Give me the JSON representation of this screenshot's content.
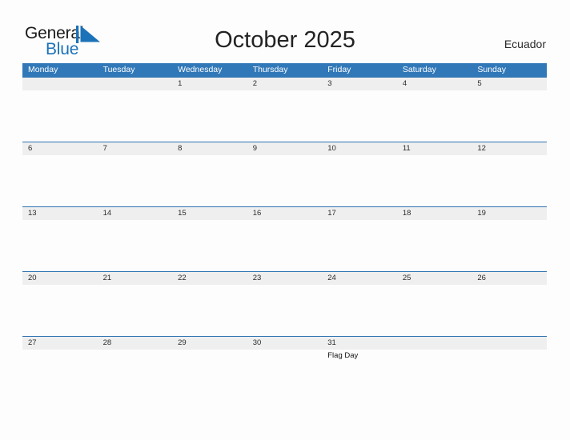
{
  "brand": {
    "line1": "General",
    "line2": "Blue",
    "mark_icon": "blue-triangle-logo-icon",
    "accent_color": "#1b72b8",
    "text_color": "#1a1a1a"
  },
  "header": {
    "title": "October 2025",
    "region": "Ecuador"
  },
  "colors": {
    "header_blue": "#3178b8",
    "row_band_gray": "#efefef",
    "row_rule_blue": "#2f74b3",
    "page_background": "#fdfdfd",
    "text_dark": "#2b2b2b"
  },
  "calendar": {
    "month": "October",
    "year": "2025",
    "weekday_headers": [
      "Monday",
      "Tuesday",
      "Wednesday",
      "Thursday",
      "Friday",
      "Saturday",
      "Sunday"
    ],
    "weeks": [
      [
        {
          "day": "",
          "event": ""
        },
        {
          "day": "",
          "event": ""
        },
        {
          "day": "1",
          "event": ""
        },
        {
          "day": "2",
          "event": ""
        },
        {
          "day": "3",
          "event": ""
        },
        {
          "day": "4",
          "event": ""
        },
        {
          "day": "5",
          "event": ""
        }
      ],
      [
        {
          "day": "6",
          "event": ""
        },
        {
          "day": "7",
          "event": ""
        },
        {
          "day": "8",
          "event": ""
        },
        {
          "day": "9",
          "event": ""
        },
        {
          "day": "10",
          "event": ""
        },
        {
          "day": "11",
          "event": ""
        },
        {
          "day": "12",
          "event": ""
        }
      ],
      [
        {
          "day": "13",
          "event": ""
        },
        {
          "day": "14",
          "event": ""
        },
        {
          "day": "15",
          "event": ""
        },
        {
          "day": "16",
          "event": ""
        },
        {
          "day": "17",
          "event": ""
        },
        {
          "day": "18",
          "event": ""
        },
        {
          "day": "19",
          "event": ""
        }
      ],
      [
        {
          "day": "20",
          "event": ""
        },
        {
          "day": "21",
          "event": ""
        },
        {
          "day": "22",
          "event": ""
        },
        {
          "day": "23",
          "event": ""
        },
        {
          "day": "24",
          "event": ""
        },
        {
          "day": "25",
          "event": ""
        },
        {
          "day": "26",
          "event": ""
        }
      ],
      [
        {
          "day": "27",
          "event": ""
        },
        {
          "day": "28",
          "event": ""
        },
        {
          "day": "29",
          "event": ""
        },
        {
          "day": "30",
          "event": ""
        },
        {
          "day": "31",
          "event": "Flag Day"
        },
        {
          "day": "",
          "event": ""
        },
        {
          "day": "",
          "event": ""
        }
      ]
    ]
  }
}
